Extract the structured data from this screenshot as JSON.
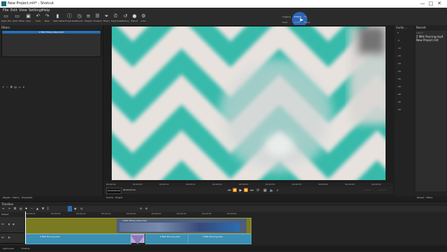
{
  "window": {
    "title": "New Project.mlt* - Shotcut",
    "controls": [
      "—",
      "□",
      "✕"
    ]
  },
  "menu": [
    "File",
    "Edit",
    "View",
    "Settings",
    "Help"
  ],
  "toolbar": [
    {
      "label": "Open File",
      "icon": "folder-icon"
    },
    {
      "label": "Open Other",
      "icon": "folder-plus-icon"
    },
    {
      "label": "Save",
      "icon": "save-icon"
    },
    {
      "label": "Undo",
      "icon": "undo-icon"
    },
    {
      "label": "Redo",
      "icon": "redo-icon"
    },
    {
      "label": "Peak Meter",
      "icon": "meter-icon"
    },
    {
      "label": "Properties",
      "icon": "info-icon"
    },
    {
      "label": "Recent",
      "icon": "clock-icon"
    },
    {
      "label": "Playlist",
      "icon": "list-icon"
    },
    {
      "label": "Timeline",
      "icon": "timeline-icon"
    },
    {
      "label": "Filters",
      "icon": "filter-icon"
    },
    {
      "label": "Keyframes",
      "icon": "stopwatch-icon"
    },
    {
      "label": "History",
      "icon": "history-icon"
    },
    {
      "label": "Export",
      "icon": "export-icon"
    },
    {
      "label": "Jobs",
      "icon": "jobs-icon"
    }
  ],
  "layouts": {
    "logging": "Logging",
    "editing": "Editing",
    "fx": "FX",
    "color": "Color",
    "audio": "Audio",
    "player": "Player"
  },
  "filters": {
    "title": "Filters",
    "clip": "2 Milk Filling Glass.mp4",
    "buttons": [
      "+",
      "−",
      "⧉",
      "▤",
      "▭",
      "▾"
    ]
  },
  "audio": {
    "title": "Audio ...",
    "scale": [
      "0",
      "-5",
      "-10",
      "-15",
      "-20",
      "-25",
      "-30",
      "-35",
      "-40",
      "-45",
      "-50"
    ]
  },
  "recent": {
    "title": "Recent",
    "search": "search",
    "items": [
      "2 Milk Pouring.mp4",
      "New Project.mlt"
    ]
  },
  "player": {
    "ruler": [
      "00:00:00",
      "00:00:05",
      "00:00:10",
      "00:00:15",
      "00:00:20",
      "00:00:25",
      "00:00:30",
      "00:00:35",
      "00:00:40",
      "00:00:45",
      "00:00:50"
    ],
    "current": "00:00:00:00",
    "duration": "00:00:23:22",
    "in": "--:--:--:--",
    "out": "--:--:--:--"
  },
  "bottom_tabs": {
    "left": [
      "Playlist",
      "History",
      "Properties"
    ],
    "center": [
      "Source",
      "Project"
    ],
    "right": [
      "Recent",
      "Filters"
    ]
  },
  "timeline": {
    "title": "Timeline",
    "output": "Output",
    "ruler": [
      "00:00:00",
      "00:00:05",
      "00:00:10",
      "00:00:15",
      "00:00:20",
      "00:00:25",
      "00:00:30",
      "00:00:35",
      "00:00:40",
      "00:00:45"
    ],
    "tracks": [
      {
        "name": "V1"
      },
      {
        "name": "A1"
      }
    ],
    "video_clip": "2 Milk Filling Glass.mp4",
    "audio_clips": [
      "2 Milk Pouring.mp4",
      "2 Milk Pouring.mp4",
      "2 Milk Pouring.mp4"
    ]
  },
  "status_tabs": [
    "Keyframes",
    "Timeline"
  ]
}
